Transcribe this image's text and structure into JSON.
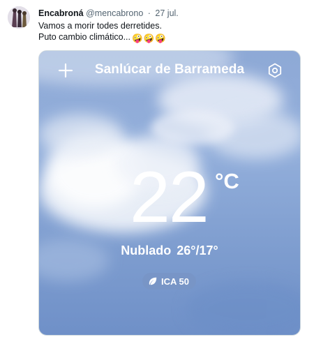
{
  "tweet": {
    "display_name": "Encabroná",
    "handle": "@mencabrono",
    "separator": "·",
    "date": "27 jul.",
    "text_line1": "Vamos a morir todes derretides.",
    "text_line2": "Puto cambio climático...",
    "emojis": [
      "🤪",
      "🤪",
      "🤪"
    ]
  },
  "weather": {
    "city": "Sanlúcar de Barrameda",
    "temperature": "22",
    "unit": "°C",
    "condition": "Nublado",
    "range": "26°/17°",
    "aqi_label": "ICA 50",
    "icons": {
      "add": "plus-icon",
      "settings": "gear-icon",
      "aqi": "leaf-icon"
    }
  },
  "colors": {
    "sky_top": "#8ea9d6",
    "sky_bottom": "#6f90c8",
    "text_primary": "#0f1419",
    "text_secondary": "#536471"
  }
}
